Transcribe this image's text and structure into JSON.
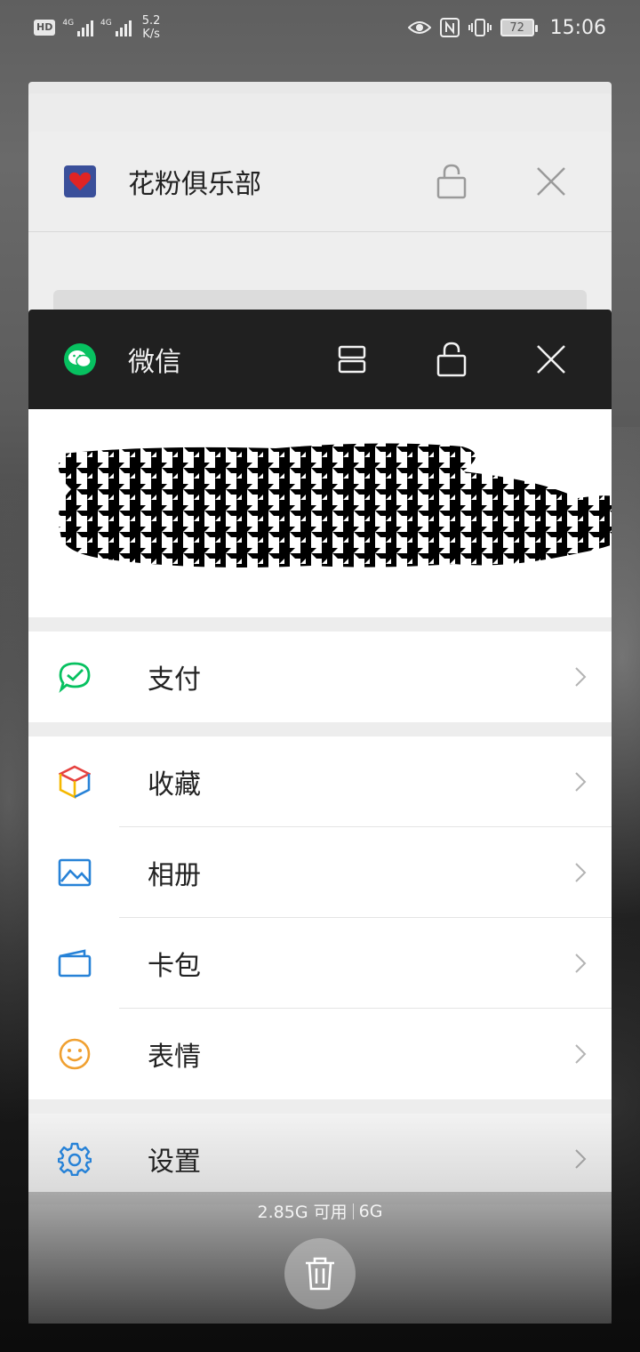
{
  "status_bar": {
    "hd": "HD",
    "sim1_label": "4G",
    "sim2_label": "4G",
    "speed_value": "5.2",
    "speed_unit": "K/s",
    "battery": "72",
    "time": "15:06"
  },
  "cards": {
    "huafen": {
      "title": "花粉俱乐部"
    },
    "wechat": {
      "title": "微信",
      "menu_groups": [
        [
          {
            "label": "支付",
            "icon": "wechat-pay-icon"
          }
        ],
        [
          {
            "label": "收藏",
            "icon": "favorites-cube-icon"
          },
          {
            "label": "相册",
            "icon": "album-icon"
          },
          {
            "label": "卡包",
            "icon": "card-wallet-icon"
          },
          {
            "label": "表情",
            "icon": "sticker-smiley-icon"
          }
        ],
        [
          {
            "label": "设置",
            "icon": "settings-gear-icon"
          }
        ]
      ]
    }
  },
  "memory": {
    "available": "2.85G 可用",
    "total": "6G"
  },
  "colors": {
    "wechat_green": "#07c160",
    "huafen_blue": "#3a4f9a",
    "huafen_heart": "#e02424"
  }
}
